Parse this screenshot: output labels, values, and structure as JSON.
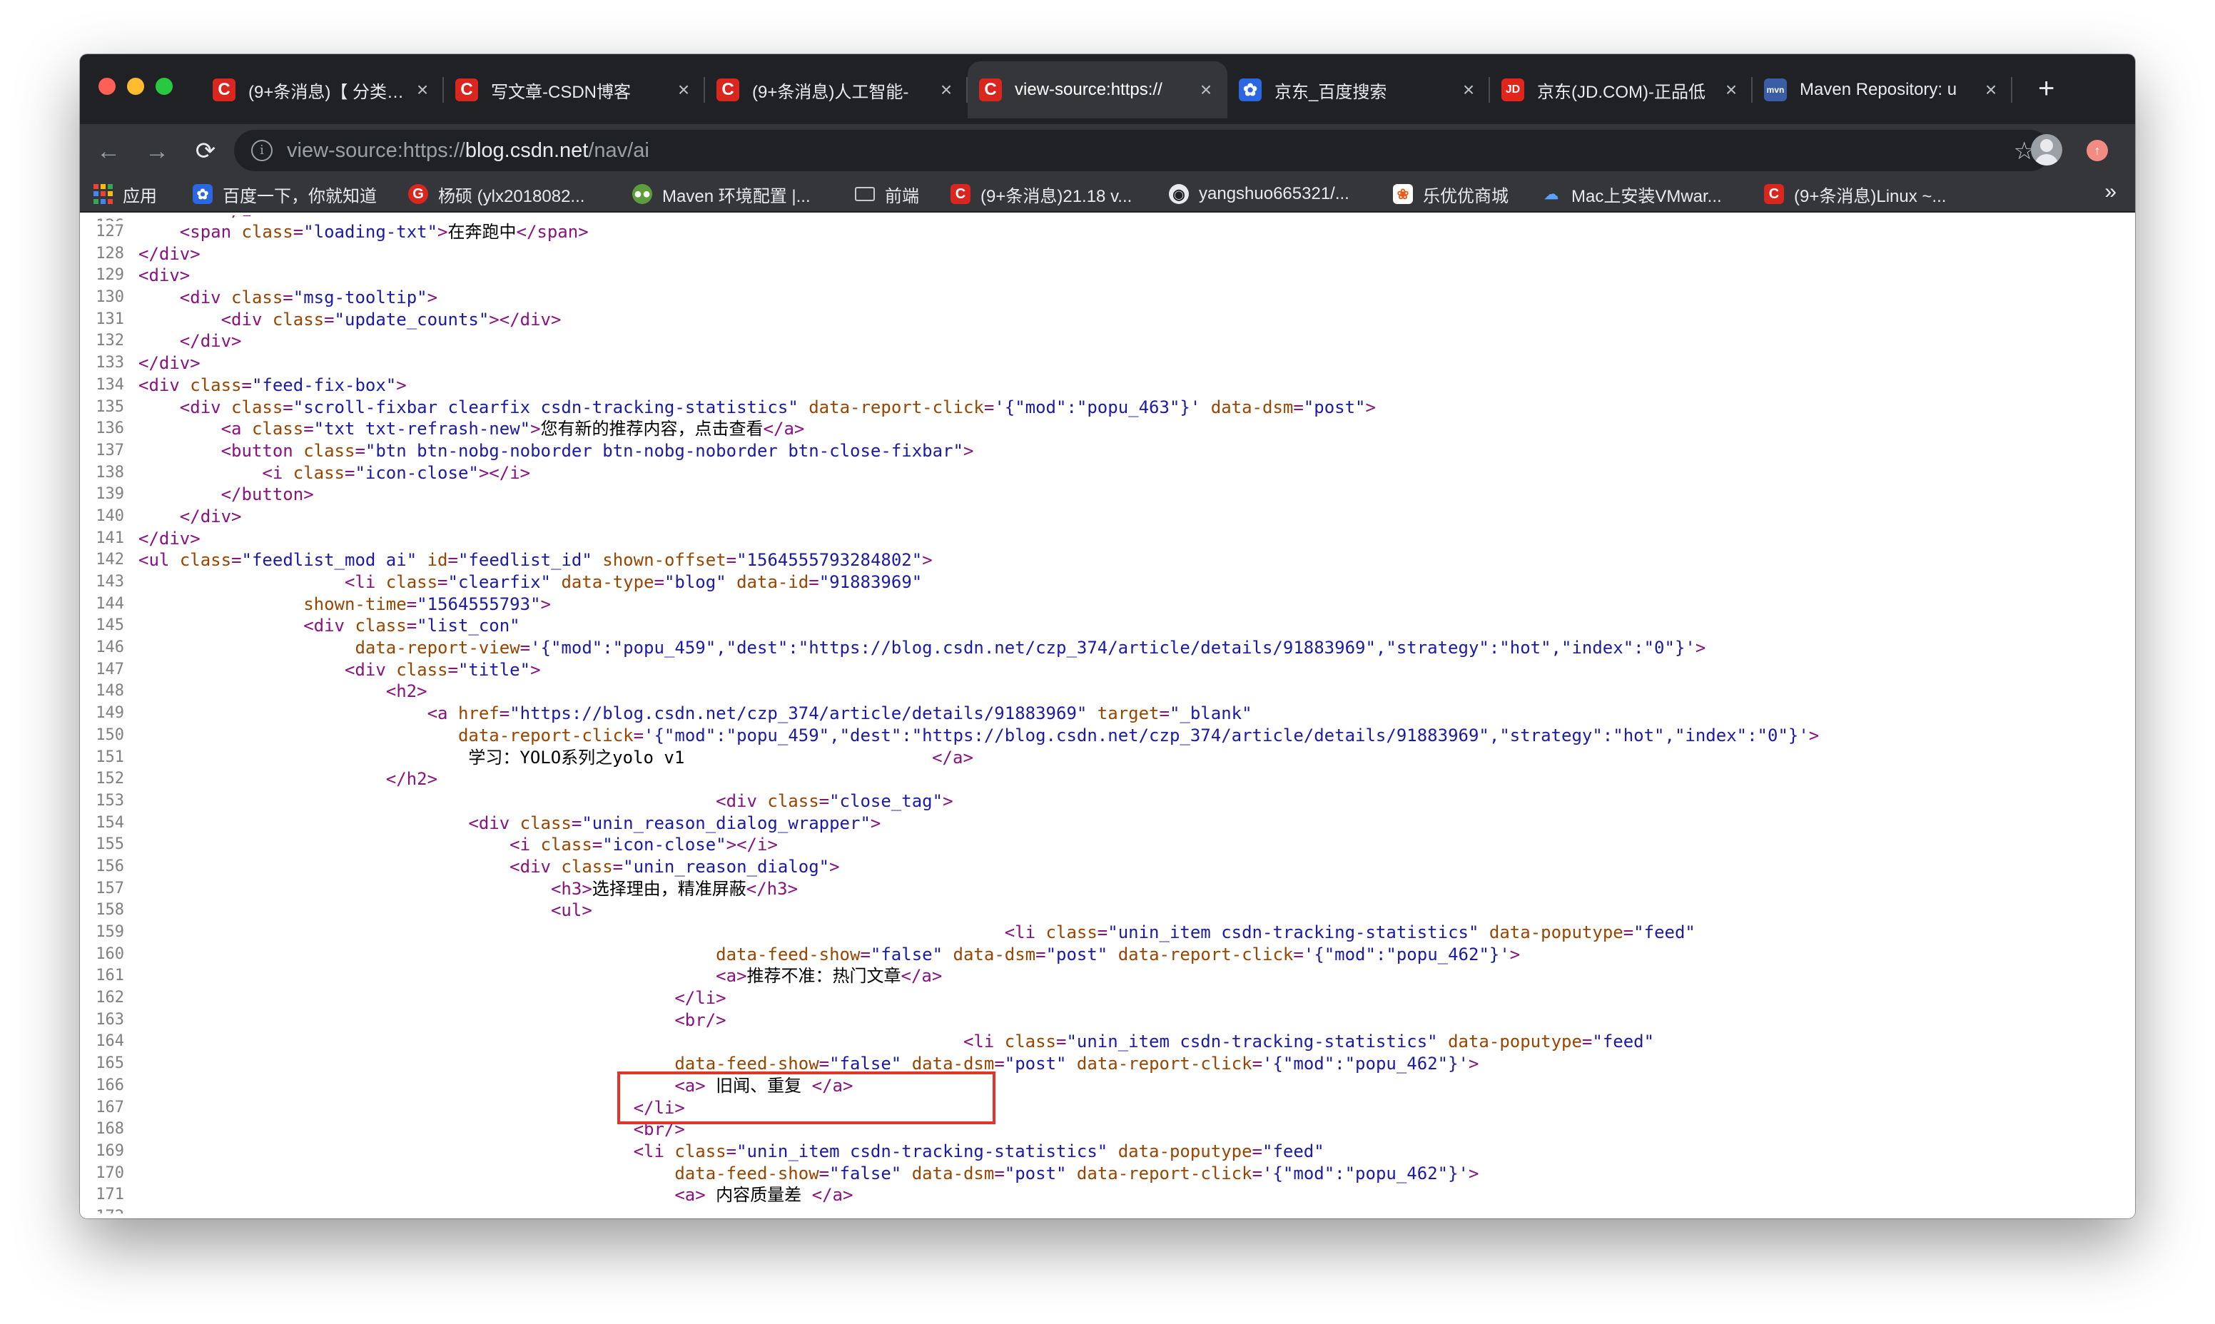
{
  "browser": {
    "tabs": [
      {
        "title": "(9+条消息)【 分类 】",
        "icon": "csdn-icon",
        "active": false
      },
      {
        "title": "写文章-CSDN博客",
        "icon": "csdn-icon",
        "active": false
      },
      {
        "title": "(9+条消息)人工智能-",
        "icon": "csdn-icon",
        "active": false
      },
      {
        "title": "view-source:https://",
        "icon": "csdn-icon",
        "active": true
      },
      {
        "title": "京东_百度搜索",
        "icon": "baidu-paw-icon",
        "active": false
      },
      {
        "title": "京东(JD.COM)-正品低",
        "icon": "jd-icon",
        "active": false
      },
      {
        "title": "Maven Repository: u",
        "icon": "maven-icon",
        "active": false
      }
    ],
    "new_tab_label": "+",
    "address": {
      "scheme": "view-source:https://",
      "host": "blog.csdn.net",
      "path": "/nav/ai"
    },
    "bookmarks": [
      {
        "label": "应用",
        "icon": "apps-grid-icon"
      },
      {
        "label": "百度一下，你就知道",
        "icon": "baidu-paw-icon"
      },
      {
        "label": "杨硕 (ylx2018082...",
        "icon": "g-icon"
      },
      {
        "label": "Maven 环境配置 |...",
        "icon": "wechat-icon"
      },
      {
        "label": "前端",
        "icon": "folder-icon"
      },
      {
        "label": "(9+条消息)21.18 v...",
        "icon": "csdn-icon"
      },
      {
        "label": "yangshuo665321/...",
        "icon": "github-icon"
      },
      {
        "label": "乐优优商城",
        "icon": "leyou-icon"
      },
      {
        "label": "Mac上安装VMwar...",
        "icon": "cloud-icon"
      },
      {
        "label": "(9+条消息)Linux ~...",
        "icon": "csdn-icon"
      }
    ],
    "bookmarks_overflow": "»"
  },
  "source": {
    "lines": [
      {
        "n": "127",
        "t": "    <span class=\"loading-txt\">在奔跑中</span>"
      },
      {
        "n": "128",
        "t": "</div>"
      },
      {
        "n": "129",
        "t": "<div>"
      },
      {
        "n": "130",
        "t": "    <div class=\"msg-tooltip\">"
      },
      {
        "n": "131",
        "t": "        <div class=\"update_counts\"></div>"
      },
      {
        "n": "132",
        "t": "    </div>"
      },
      {
        "n": "133",
        "t": "</div>"
      },
      {
        "n": "134",
        "t": "<div class=\"feed-fix-box\">"
      },
      {
        "n": "135",
        "t": "    <div class=\"scroll-fixbar clearfix csdn-tracking-statistics\" data-report-click='{\"mod\":\"popu_463\"}' data-dsm=\"post\">"
      },
      {
        "n": "136",
        "t": "        <a class=\"txt txt-refrash-new\">您有新的推荐内容，点击查看</a>"
      },
      {
        "n": "137",
        "t": "        <button class=\"btn btn-nobg-noborder btn-nobg-noborder btn-close-fixbar\">"
      },
      {
        "n": "138",
        "t": "            <i class=\"icon-close\"></i>"
      },
      {
        "n": "139",
        "t": "        </button>"
      },
      {
        "n": "140",
        "t": "    </div>"
      },
      {
        "n": "141",
        "t": "</div>"
      },
      {
        "n": "142",
        "t": "<ul class=\"feedlist_mod ai\" id=\"feedlist_id\" shown-offset=\"1564555793284802\">"
      },
      {
        "n": "143",
        "t": "                    <li class=\"clearfix\" data-type=\"blog\" data-id=\"91883969\""
      },
      {
        "n": "144",
        "t": "                shown-time=\"1564555793\">"
      },
      {
        "n": "145",
        "t": "                <div class=\"list_con\""
      },
      {
        "n": "146",
        "t": "                     data-report-view='{\"mod\":\"popu_459\",\"dest\":\"https://blog.csdn.net/czp_374/article/details/91883969\",\"strategy\":\"hot\",\"index\":\"0\"}'>"
      },
      {
        "n": "147",
        "t": "                    <div class=\"title\">"
      },
      {
        "n": "148",
        "t": "                        <h2>"
      },
      {
        "n": "149",
        "t": "                            <a href=\"https://blog.csdn.net/czp_374/article/details/91883969\" target=\"_blank\""
      },
      {
        "n": "150",
        "t": "                               data-report-click='{\"mod\":\"popu_459\",\"dest\":\"https://blog.csdn.net/czp_374/article/details/91883969\",\"strategy\":\"hot\",\"index\":\"0\"}'>"
      },
      {
        "n": "151",
        "t": "                                学习：YOLO系列之yolo v1                        </a>"
      },
      {
        "n": "152",
        "t": "                        </h2>"
      },
      {
        "n": "153",
        "t": "                                                        <div class=\"close_tag\">"
      },
      {
        "n": "154",
        "t": "                                <div class=\"unin_reason_dialog_wrapper\">"
      },
      {
        "n": "155",
        "t": "                                    <i class=\"icon-close\"></i>"
      },
      {
        "n": "156",
        "t": "                                    <div class=\"unin_reason_dialog\">"
      },
      {
        "n": "157",
        "t": "                                        <h3>选择理由，精准屏蔽</h3>"
      },
      {
        "n": "158",
        "t": "                                        <ul>"
      },
      {
        "n": "159",
        "t": "                                                                                    <li class=\"unin_item csdn-tracking-statistics\" data-poputype=\"feed\""
      },
      {
        "n": "160",
        "t": "                                                        data-feed-show=\"false\" data-dsm=\"post\" data-report-click='{\"mod\":\"popu_462\"}'>"
      },
      {
        "n": "161",
        "t": "                                                        <a>推荐不准：热门文章</a>"
      },
      {
        "n": "162",
        "t": "                                                    </li>"
      },
      {
        "n": "163",
        "t": "                                                    <br/>"
      },
      {
        "n": "164",
        "t": "                                                                                <li class=\"unin_item csdn-tracking-statistics\" data-poputype=\"feed\""
      },
      {
        "n": "165",
        "t": "                                                    data-feed-show=\"false\" data-dsm=\"post\" data-report-click='{\"mod\":\"popu_462\"}'>"
      },
      {
        "n": "166",
        "t": "                                                    <a> 旧闻、重复 </a>"
      },
      {
        "n": "167",
        "t": "                                                </li>"
      },
      {
        "n": "168",
        "t": "                                                <br/>"
      },
      {
        "n": "169",
        "t": "                                                <li class=\"unin_item csdn-tracking-statistics\" data-poputype=\"feed\""
      },
      {
        "n": "170",
        "t": "                                                    data-feed-show=\"false\" data-dsm=\"post\" data-report-click='{\"mod\":\"popu_462\"}'>"
      },
      {
        "n": "171",
        "t": "                                                    <a> 内容质量差 </a>"
      }
    ],
    "highlight": {
      "first_line": "156",
      "last_line": "157"
    }
  },
  "colors": {
    "tag": "#881280",
    "attribute_name": "#994500",
    "attribute_value": "#1a1aa6",
    "line_number": "#808080",
    "highlight_box": "#e0352b",
    "tabstrip": "#202124",
    "toolbar": "#35363a"
  }
}
